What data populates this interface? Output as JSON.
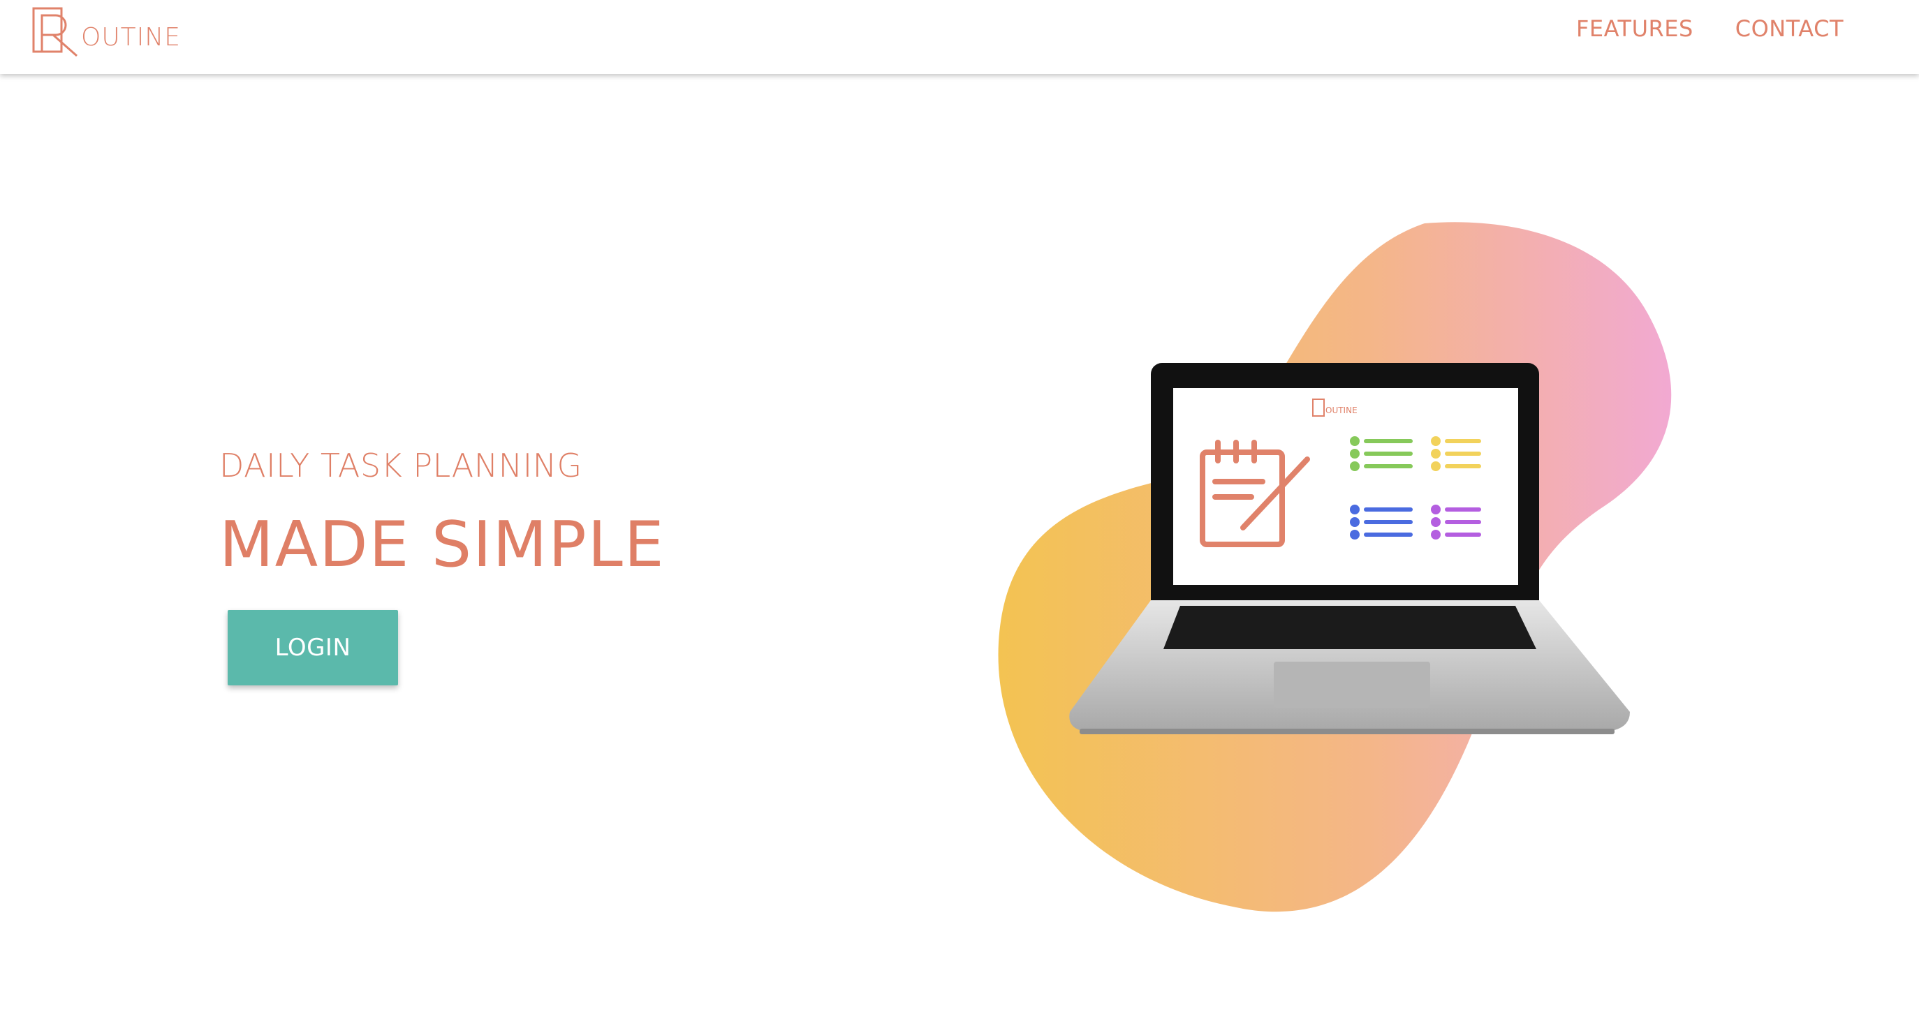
{
  "brand": {
    "letter": "R",
    "rest": "OUTINE",
    "color": "#e0826a"
  },
  "nav": {
    "features": "FEATURES",
    "contact": "CONTACT"
  },
  "hero": {
    "subtitle": "DAILY TASK PLANNING",
    "title": "MADE SIMPLE",
    "login_label": "LOGIN",
    "accent_color": "#df7f66",
    "button_color": "#5bb9ab"
  },
  "illustration": {
    "screen_logo_letter": "R",
    "screen_logo_rest": "OUTINE",
    "blob_gradient": [
      "#f3c352",
      "#f4b688",
      "#f2a9d2"
    ],
    "list_colors": [
      "#86c95a",
      "#f2d25b",
      "#4a6be0",
      "#b45ee0"
    ]
  }
}
